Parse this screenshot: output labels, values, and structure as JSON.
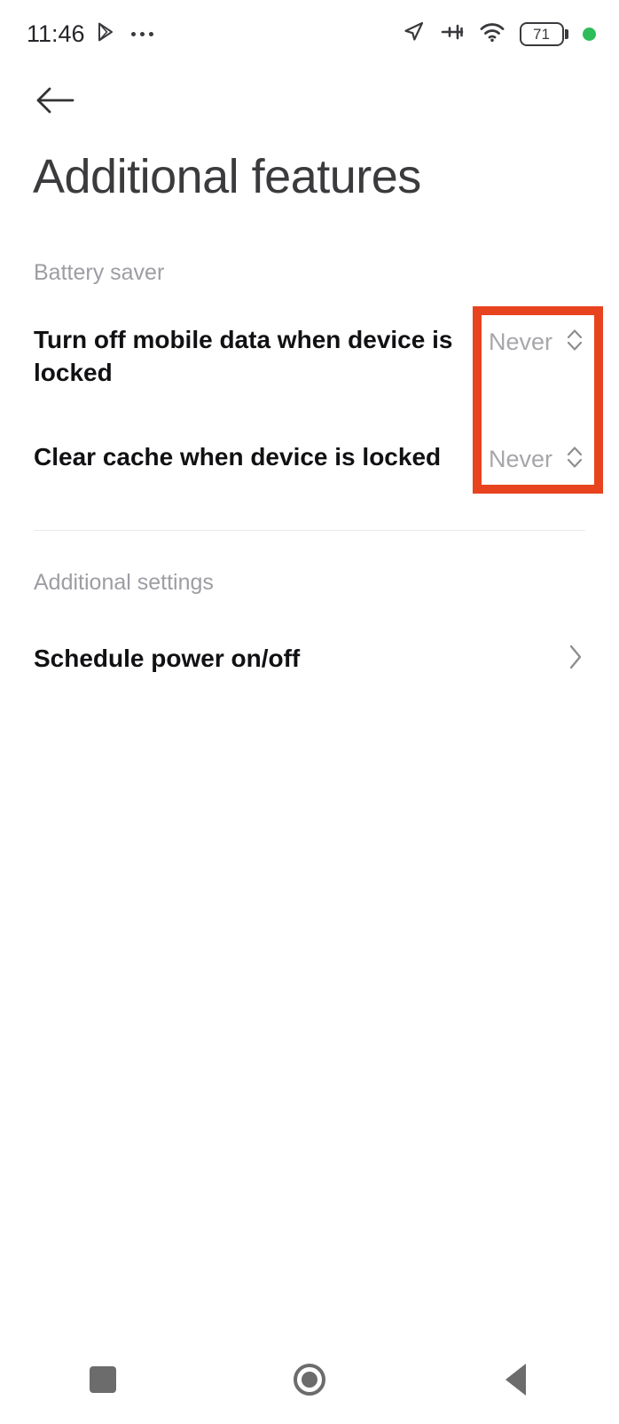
{
  "status_bar": {
    "time": "11:46",
    "left_icons": [
      "play-store-icon",
      "ellipsis-icon"
    ],
    "right_icons": [
      "location-arrow-icon",
      "airplane-mode-icon",
      "wifi-icon"
    ],
    "battery_level": "71",
    "notification_dot_color": "#2ebd59"
  },
  "header": {
    "back_icon": "back-arrow-icon",
    "title": "Additional features"
  },
  "sections": [
    {
      "label": "Battery saver",
      "rows": [
        {
          "title": "Turn off mobile data when device is locked",
          "value": "Never",
          "control": "stepper-icon"
        },
        {
          "title": "Clear cache when device is locked",
          "value": "Never",
          "control": "stepper-icon"
        }
      ]
    },
    {
      "label": "Additional settings",
      "rows": [
        {
          "title": "Schedule power on/off",
          "value": "",
          "control": "chevron-right-icon"
        }
      ]
    }
  ],
  "highlight": {
    "color": "#e8431f",
    "target": "battery-saver-value-steppers"
  },
  "nav_bar": {
    "recents_label": "recents-square-icon",
    "home_label": "home-circle-icon",
    "back_label": "back-triangle-icon",
    "color": "#6c6c6c"
  }
}
